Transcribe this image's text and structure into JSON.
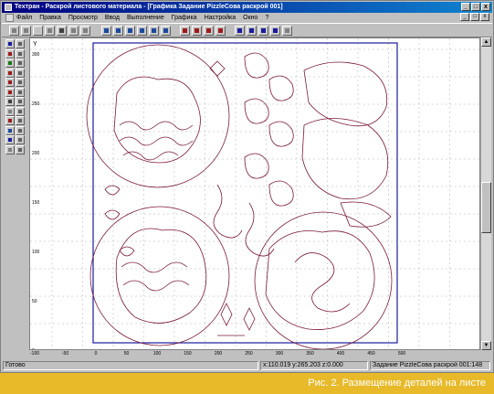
{
  "window": {
    "title": "Техтран - Раскрой листового материала - [Графика Задание PizzleСова раскрой 001]",
    "min": "_",
    "max": "□",
    "close": "x"
  },
  "menu": [
    "Файл",
    "Правка",
    "Просмотр",
    "Ввод",
    "Выполнение",
    "Графика",
    "Настройка",
    "Окно",
    "?"
  ],
  "mdi_buttons": [
    "_",
    "□",
    "x"
  ],
  "canvas": {
    "y_ticks": [
      "300",
      "250",
      "200",
      "150",
      "100",
      "50",
      "0"
    ],
    "y_axis_label": "Y",
    "x_ticks": [
      "-100",
      "-50",
      "0",
      "50",
      "100",
      "150",
      "200",
      "250",
      "300",
      "350",
      "400",
      "450",
      "500"
    ]
  },
  "status": {
    "ready": "Готово",
    "coords": "x:110.019 y:265.203 z:0.000",
    "doc": "Задание PizzleСова раскрой 001:148"
  },
  "caption": "Рис. 2. Размещение деталей на листе",
  "colors": {
    "titlebar": "#000080",
    "contour": "#7a1a3a",
    "sheet": "#1a1a9e",
    "caption_bg": "#e8ba2a"
  }
}
